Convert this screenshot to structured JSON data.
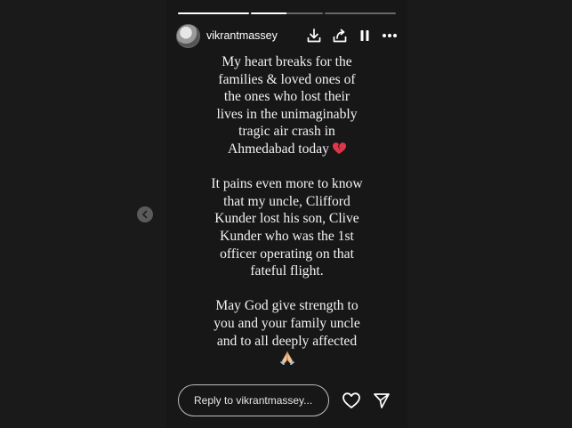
{
  "story": {
    "username": "vikrantmassey",
    "progress": [
      1.0,
      0.5,
      0.0
    ],
    "lines_block1": [
      "My heart breaks for the",
      "families & loved ones of",
      "the ones who lost their",
      "lives in the unimaginably",
      "tragic air crash in",
      "Ahmedabad today"
    ],
    "lines_block2": [
      "It pains even more to know",
      "that my uncle, Clifford",
      "Kunder lost his son, Clive",
      "Kunder who was the 1st",
      "officer operating on that",
      "fateful flight."
    ],
    "lines_block3": [
      "May God give strength to",
      "you and your family uncle",
      "and to all deeply affected"
    ],
    "emoji_heart": "broken-heart-icon",
    "emoji_pray": "folded-hands-icon"
  },
  "footer": {
    "reply_placeholder": "Reply to vikrantmassey..."
  },
  "icons": [
    "download-icon",
    "share-icon",
    "pause-icon",
    "more-icon",
    "heart-icon",
    "send-icon",
    "chevron-left-icon"
  ],
  "colors": {
    "background": "#1a1a1a",
    "story_bg": "#171717",
    "text": "#f2f2f2",
    "heart_red": "#e0364a"
  }
}
